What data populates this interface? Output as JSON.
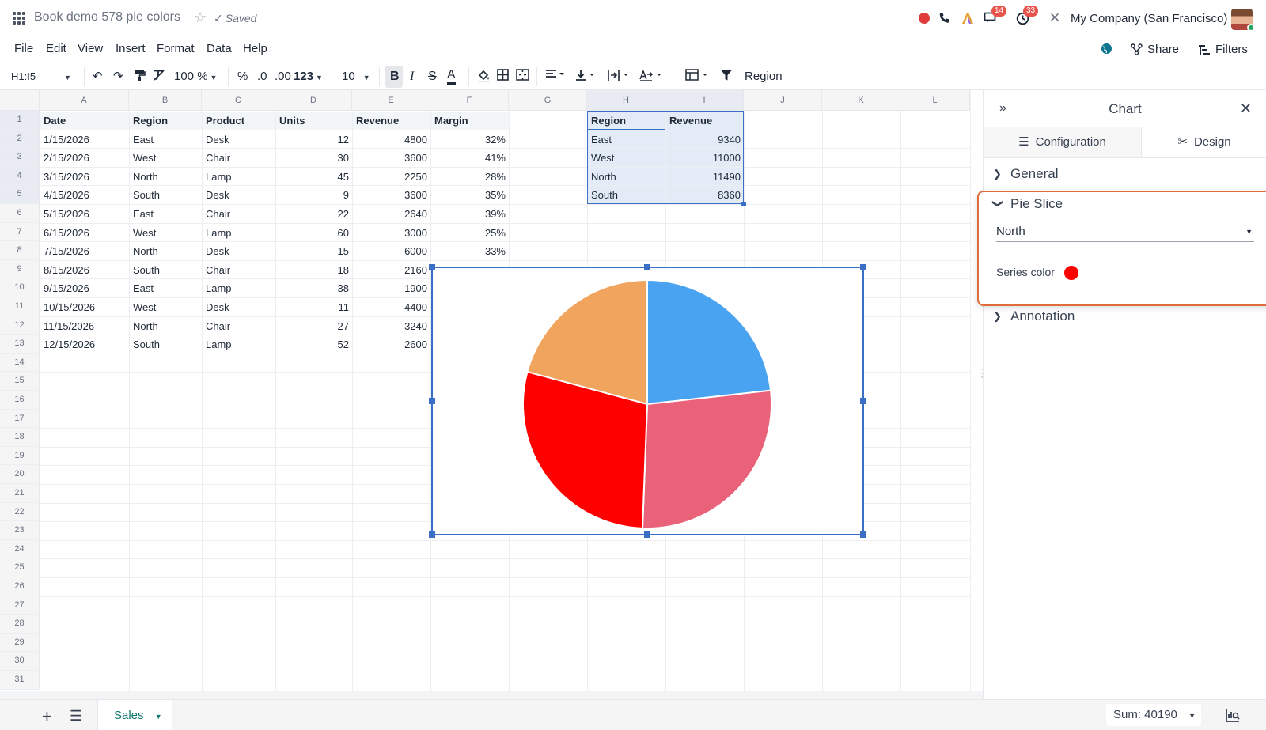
{
  "header": {
    "title": "Book demo 578 pie colors",
    "saved_label": "Saved",
    "company": "My Company (San Francisco)",
    "chat_badge": "14",
    "activity_badge": "33"
  },
  "menu": {
    "items": [
      "File",
      "Edit",
      "View",
      "Insert",
      "Format",
      "Data",
      "Help"
    ],
    "share": "Share",
    "filters": "Filters"
  },
  "toolbar": {
    "cell_ref": "H1:I5",
    "zoom": "100 %",
    "percent": "%",
    "dec_less": ".0",
    "dec_more": ".00",
    "num_format": "123",
    "font_size": "10",
    "formula": "Region"
  },
  "grid": {
    "columns": [
      "A",
      "B",
      "C",
      "D",
      "E",
      "F",
      "G",
      "H",
      "I",
      "J",
      "K",
      "L"
    ],
    "rows": [
      "1",
      "2",
      "3",
      "4",
      "5",
      "6",
      "7",
      "8",
      "9",
      "10",
      "11",
      "12",
      "13",
      "14",
      "15",
      "16",
      "17",
      "18",
      "19",
      "20",
      "21",
      "22",
      "23",
      "24",
      "25",
      "26",
      "27",
      "28",
      "29",
      "30",
      "31"
    ],
    "headers": [
      "Date",
      "Region",
      "Product",
      "Units",
      "Revenue",
      "Margin"
    ],
    "data": [
      [
        "1/15/2026",
        "East",
        "Desk",
        "12",
        "4800",
        "32%"
      ],
      [
        "2/15/2026",
        "West",
        "Chair",
        "30",
        "3600",
        "41%"
      ],
      [
        "3/15/2026",
        "North",
        "Lamp",
        "45",
        "2250",
        "28%"
      ],
      [
        "4/15/2026",
        "South",
        "Desk",
        "9",
        "3600",
        "35%"
      ],
      [
        "5/15/2026",
        "East",
        "Chair",
        "22",
        "2640",
        "39%"
      ],
      [
        "6/15/2026",
        "West",
        "Lamp",
        "60",
        "3000",
        "25%"
      ],
      [
        "7/15/2026",
        "North",
        "Desk",
        "15",
        "6000",
        "33%"
      ],
      [
        "8/15/2026",
        "South",
        "Chair",
        "18",
        "2160",
        ""
      ],
      [
        "9/15/2026",
        "East",
        "Lamp",
        "38",
        "1900",
        ""
      ],
      [
        "10/15/2026",
        "West",
        "Desk",
        "11",
        "4400",
        ""
      ],
      [
        "11/15/2026",
        "North",
        "Chair",
        "27",
        "3240",
        ""
      ],
      [
        "12/15/2026",
        "South",
        "Lamp",
        "52",
        "2600",
        ""
      ]
    ],
    "summary_headers": [
      "Region",
      "Revenue"
    ],
    "summary": [
      [
        "East",
        "9340"
      ],
      [
        "West",
        "11000"
      ],
      [
        "North",
        "11490"
      ],
      [
        "South",
        "8360"
      ]
    ]
  },
  "chart_data": {
    "type": "pie",
    "categories": [
      "East",
      "West",
      "North",
      "South"
    ],
    "values": [
      9340,
      11000,
      11490,
      8360
    ],
    "colors": [
      "#4aa3f0",
      "#e9627a",
      "#ff0000",
      "#f0a45e"
    ]
  },
  "panel": {
    "title": "Chart",
    "tabs": [
      "Configuration",
      "Design"
    ],
    "sections": {
      "general": "General",
      "pie_slice": "Pie Slice",
      "annotation": "Annotation"
    },
    "slice_select": "North",
    "series_color_label": "Series color",
    "series_color": "#ff0000"
  },
  "bottom": {
    "sheet_name": "Sales",
    "sum": "Sum: 40190"
  }
}
